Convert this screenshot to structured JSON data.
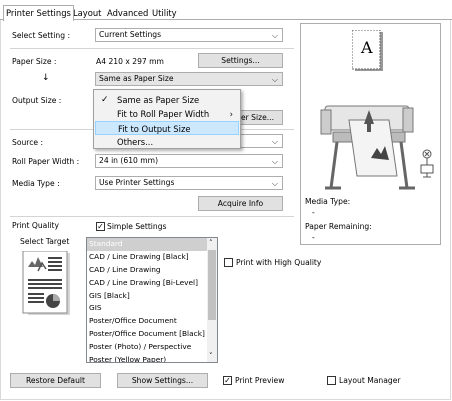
{
  "tabs": [
    "Printer Settings",
    "Layout",
    "Advanced",
    "Utility"
  ],
  "select_setting": {
    "label": "Select Setting :",
    "value": "Current Settings"
  },
  "paper_size": {
    "label": "Paper Size :",
    "value": "A4 210 x 297 mm",
    "button": "Settings...",
    "arrow": "↓",
    "mode": "Same as Paper Size"
  },
  "output_size": {
    "label": "Output Size :",
    "button_partial": "aper Size..."
  },
  "menu": {
    "items": [
      "Same as Paper Size",
      "Fit to Roll Paper Width",
      "Fit to Output Size",
      "Others..."
    ],
    "checked": "✓",
    "submenu_arrow": "›"
  },
  "source": {
    "label": "Source :"
  },
  "roll_width": {
    "label": "Roll Paper Width :",
    "value": "24 in (610 mm)"
  },
  "media_type": {
    "label": "Media Type :",
    "value": "Use Printer Settings",
    "button": "Acquire Info"
  },
  "print_quality": {
    "label": "Print Quality",
    "simple_settings": "Simple Settings",
    "select_target": "Select Target",
    "high_quality": "Print with High Quality"
  },
  "targets": [
    "Standard",
    "CAD / Line Drawing [Black]",
    "CAD / Line Drawing",
    "CAD / Line Drawing [Bi-Level]",
    "GIS [Black]",
    "GIS",
    "Poster/Office Document",
    "Poster/Office Document [Black]",
    "Poster (Photo) / Perspective",
    "Poster (Yellow Paper)"
  ],
  "info": {
    "media_type_label": "Media Type:",
    "media_type_value": "-",
    "paper_remaining_label": "Paper Remaining:",
    "paper_remaining_value": "-",
    "paper_letter": "A"
  },
  "footer": {
    "restore": "Restore Default",
    "show_settings": "Show Settings...",
    "print_preview": "Print Preview",
    "layout_manager": "Layout Manager"
  },
  "colors": {
    "accent": "#0078d7",
    "menu_highlight": "#cce8ff",
    "button": "#e1e1e1"
  }
}
